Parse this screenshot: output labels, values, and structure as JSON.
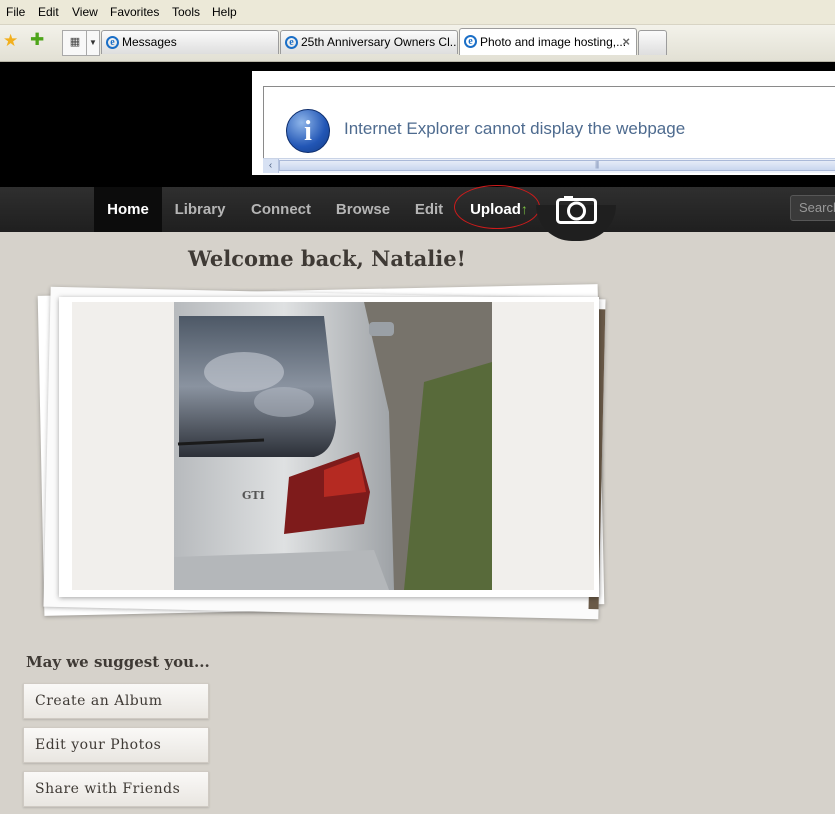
{
  "menu": [
    "File",
    "Edit",
    "View",
    "Favorites",
    "Tools",
    "Help"
  ],
  "tabs": [
    {
      "label": "Messages",
      "active": false
    },
    {
      "label": "25th Anniversary Owners Cl...",
      "active": false
    },
    {
      "label": "Photo and image hosting,...",
      "active": true
    }
  ],
  "icons": {
    "favorites": "star-icon",
    "add_favorite": "add-favorites-icon",
    "quick_tabs": "quick-tabs-icon",
    "tab_list": "chevron-down-icon",
    "tab_close": "close-icon",
    "ie": "ie-icon",
    "info": "info-icon",
    "camera": "camera-icon",
    "upload_arrow": "arrow-up-icon"
  },
  "error": {
    "message": "Internet Explorer cannot display the webpage",
    "info_glyph": "i"
  },
  "nav": {
    "items": [
      "Home",
      "Library",
      "Connect",
      "Browse",
      "Edit"
    ],
    "upload": "Upload",
    "upload_glyph": "↑",
    "search_placeholder": "Search"
  },
  "main": {
    "welcome": "Welcome back, Natalie!",
    "suggest_heading": "May we suggest you...",
    "actions": [
      "Create an Album",
      "Edit your Photos",
      "Share with Friends"
    ]
  },
  "colors": {
    "nav_bg": "#262626",
    "accent_upload_arrow": "#7bc142",
    "annotation_circle": "#cf1b1b",
    "page_bg": "#d6d2cb"
  }
}
